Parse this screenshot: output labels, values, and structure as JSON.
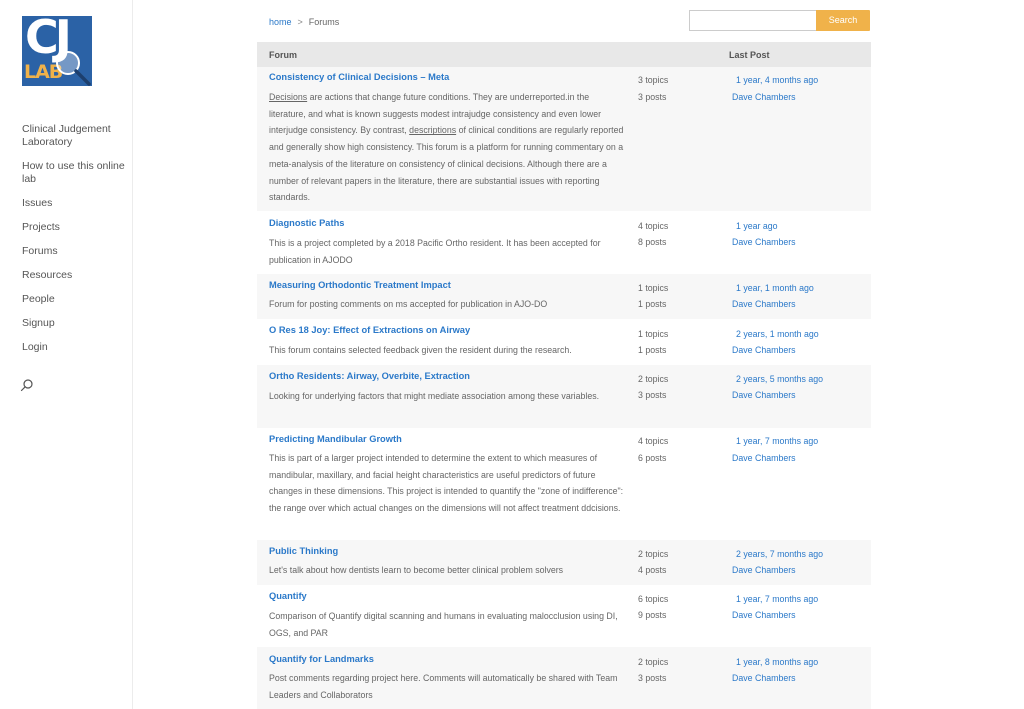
{
  "sidebar": {
    "logo_text": "CJ LAB",
    "nav": [
      "Clinical Judgement Laboratory",
      "How to use this online lab",
      "Issues",
      "Projects",
      "Forums",
      "Resources",
      "People",
      "Signup",
      "Login"
    ],
    "search_icon": "search-icon"
  },
  "breadcrumb": {
    "home": "home",
    "separator": ">",
    "current": "Forums"
  },
  "search": {
    "placeholder": "",
    "button": "Search"
  },
  "table": {
    "headers": {
      "forum": "Forum",
      "last_post": "Last Post"
    },
    "rows": [
      {
        "title": "Consistency of Clinical Decisions – Meta",
        "desc_pre": "",
        "desc_u1": "Decisions",
        "desc_mid": " are actions that change future conditions.  They are underreported.in the literature, and what is known suggests modest intrajudge consistency and even lower interjudge consistency. By contrast, ",
        "desc_u2": "descriptions",
        "desc_post": " of clinical conditions are regularly reported and generally show high consistency. This forum is a platform for running commentary on a meta-analysis of the literature on consistency of clinical decisions. Although there are a number of relevant papers in the literature, there are substantial issues with reporting standards.",
        "topics": "3 topics",
        "posts": "3 posts",
        "freshness": "1 year, 4 months ago",
        "author": "Dave Chambers"
      },
      {
        "title": "Diagnostic Paths",
        "desc": "This is a project completed by a 2018 Pacific Ortho resident.  It has been accepted for publication in AJODO",
        "topics": "4 topics",
        "posts": "8 posts",
        "freshness": "1 year ago",
        "author": "Dave Chambers"
      },
      {
        "title": "Measuring Orthodontic Treatment Impact",
        "desc": "Forum for posting comments on ms accepted for publication in AJO-DO",
        "topics": "1 topics",
        "posts": "1 posts",
        "freshness": "1 year, 1 month ago",
        "author": "Dave Chambers"
      },
      {
        "title": "O Res 18 Joy: Effect of Extractions on Airway",
        "desc": "This forum contains selected feedback given the resident during the research.",
        "topics": "1 topics",
        "posts": "1 posts",
        "freshness": "2 years, 1 month ago",
        "author": "Dave Chambers"
      },
      {
        "title": "Ortho Residents: Airway, Overbite, Extraction",
        "desc": "Looking for underlying factors that might mediate association among these variables.",
        "topics": "2 topics",
        "posts": "3 posts",
        "freshness": "2 years, 5 months ago",
        "author": "Dave Chambers"
      },
      {
        "title": "Predicting Mandibular Growth",
        "desc": "This is part of a larger project intended to determine the extent to which measures of mandibular, maxillary, and facial height characteristics are useful predictors of future changes in these dimensions.  This project is intended to quantify the \"zone of indifference\": the range over which actual changes on the dimensions will not affect treatment ddcisions.",
        "topics": "4 topics",
        "posts": "6 posts",
        "freshness": "1 year, 7 months ago",
        "author": "Dave Chambers"
      },
      {
        "title": "Public Thinking",
        "desc": "Let's talk about how dentists learn to become better clinical problem solvers",
        "topics": "2 topics",
        "posts": "4 posts",
        "freshness": "2 years, 7 months ago",
        "author": "Dave Chambers"
      },
      {
        "title": "Quantify",
        "desc": "Comparison of Quantify digital scanning and humans in evaluating malocclusion using DI, OGS, and PAR",
        "topics": "6 topics",
        "posts": "9 posts",
        "freshness": "1 year, 7 months ago",
        "author": "Dave Chambers"
      },
      {
        "title": "Quantify for Landmarks",
        "desc": "Post comments regarding project here.  Comments will automatically be shared with Team Leaders and Collaborators",
        "topics": "2 topics",
        "posts": "3 posts",
        "freshness": "1 year, 8 months ago",
        "author": "Dave Chambers"
      }
    ]
  }
}
